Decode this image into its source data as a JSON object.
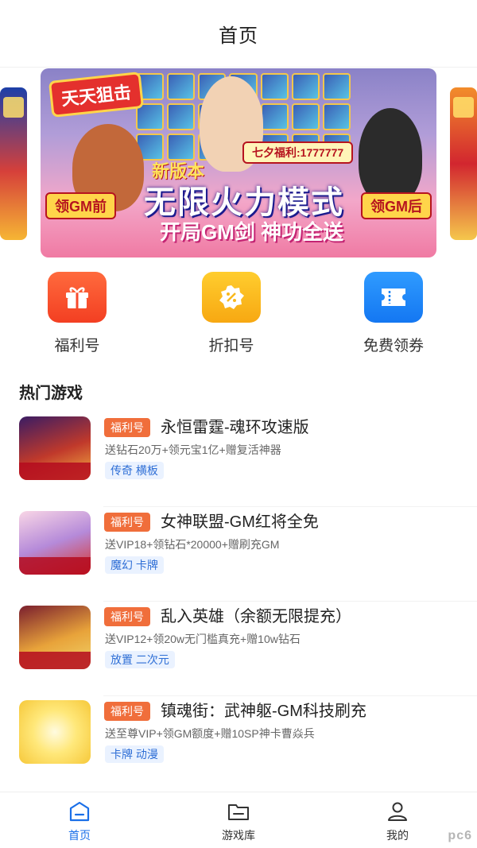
{
  "header": {
    "title": "首页"
  },
  "banner": {
    "logo_text": "天天狙击",
    "new_version": "新版本",
    "headline": "无限火力模式",
    "subline": "开局GM剑 神功全送",
    "tag_left": "领GM前",
    "tag_right": "领GM后",
    "tag_top": "七夕福利:1777777"
  },
  "quick_entries": [
    {
      "label": "福利号",
      "icon": "gift-icon",
      "color": "#f84a2c"
    },
    {
      "label": "折扣号",
      "icon": "discount-icon",
      "color": "#f9b81b"
    },
    {
      "label": "免费领券",
      "icon": "ticket-icon",
      "color": "#1f86f6"
    }
  ],
  "section": {
    "title": "热门游戏"
  },
  "games": [
    {
      "badge": "福利号",
      "name": "永恒雷霆-魂环攻速版",
      "desc": "送钻石20万+领元宝1亿+赠复活神器",
      "tags": "传奇 横板"
    },
    {
      "badge": "福利号",
      "name": "女神联盟-GM红将全免",
      "desc": "送VIP18+领钻石*20000+赠刷充GM",
      "tags": "魔幻 卡牌"
    },
    {
      "badge": "福利号",
      "name": "乱入英雄（余额无限提充）",
      "desc": "送VIP12+领20w无门槛真充+赠10w钻石",
      "tags": "放置 二次元"
    },
    {
      "badge": "福利号",
      "name": "镇魂街：武神躯-GM科技刷充",
      "desc": "送至尊VIP+领GM额度+赠10SP神卡曹焱兵",
      "tags": "卡牌 动漫"
    }
  ],
  "tabbar": {
    "items": [
      {
        "label": "首页",
        "icon": "home-icon",
        "active": true
      },
      {
        "label": "游戏库",
        "icon": "folder-icon",
        "active": false
      },
      {
        "label": "我的",
        "icon": "user-icon",
        "active": false
      }
    ],
    "active_color": "#1a6fe8"
  },
  "watermark": "pc6"
}
